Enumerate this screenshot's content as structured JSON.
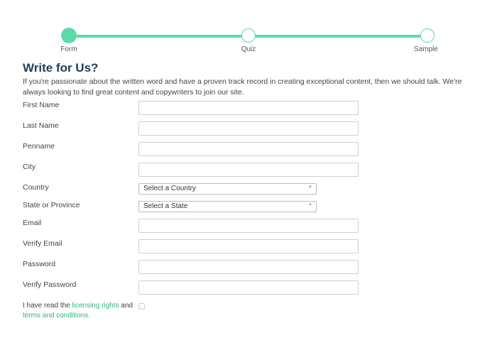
{
  "stepper": {
    "steps": [
      {
        "label": "Form",
        "state": "active"
      },
      {
        "label": "Quiz",
        "state": "inactive"
      },
      {
        "label": "Sample",
        "state": "inactive"
      }
    ],
    "accent_color": "#5ddba7"
  },
  "page": {
    "title": "Write for Us?",
    "intro": "If you're passionate about the written word and have a proven track record in creating exceptional content, then we should talk. We're always looking to find great content and copywriters to join our site."
  },
  "form": {
    "first_name": {
      "label": "First Name",
      "value": ""
    },
    "last_name": {
      "label": "Last Name",
      "value": ""
    },
    "penname": {
      "label": "Penname",
      "value": ""
    },
    "city": {
      "label": "City",
      "value": ""
    },
    "country": {
      "label": "Country",
      "selected": "Select a Country"
    },
    "state": {
      "label": "State or Province",
      "selected": "Select a State"
    },
    "email": {
      "label": "Email",
      "value": ""
    },
    "verify_email": {
      "label": "Verify Email",
      "value": ""
    },
    "password": {
      "label": "Password",
      "value": ""
    },
    "verify_password": {
      "label": "Verify Password",
      "value": ""
    },
    "terms": {
      "prefix": "I have read the ",
      "link1": "licensing rights",
      "middle": " and ",
      "link2": "terms and conditions.",
      "checked": false
    }
  },
  "colors": {
    "title": "#1e3f5a",
    "link": "#2db67c"
  }
}
